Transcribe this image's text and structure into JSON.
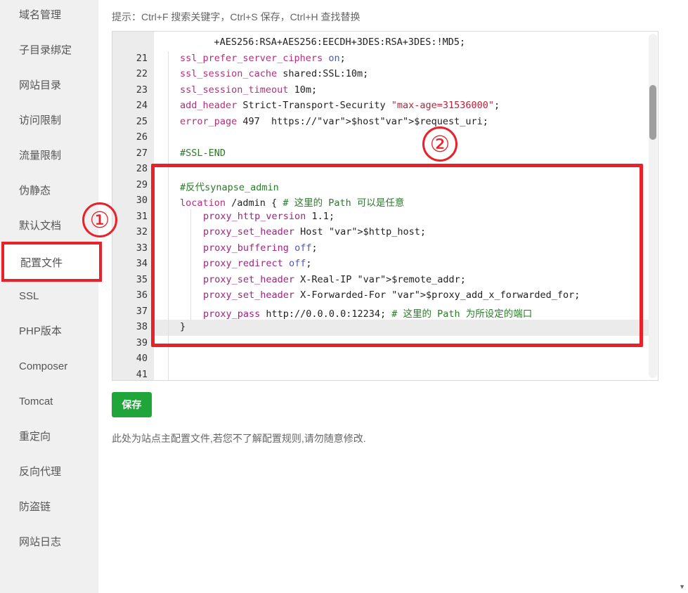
{
  "sidebar": {
    "items": [
      {
        "label": "域名管理"
      },
      {
        "label": "子目录绑定"
      },
      {
        "label": "网站目录"
      },
      {
        "label": "访问限制"
      },
      {
        "label": "流量限制"
      },
      {
        "label": "伪静态"
      },
      {
        "label": "默认文档"
      },
      {
        "label": "配置文件",
        "active": true
      },
      {
        "label": "SSL"
      },
      {
        "label": "PHP版本"
      },
      {
        "label": "Composer"
      },
      {
        "label": "Tomcat"
      },
      {
        "label": "重定向"
      },
      {
        "label": "反向代理"
      },
      {
        "label": "防盗链"
      },
      {
        "label": "网站日志"
      }
    ]
  },
  "hint": "提示：Ctrl+F 搜索关键字，Ctrl+S 保存，Ctrl+H 查找替换",
  "editor": {
    "lines": [
      {
        "n": "",
        "text": "    +AES256:RSA+AES256:EECDH+3DES:RSA+3DES:!MD5;"
      },
      {
        "n": "21",
        "text": "ssl_prefer_server_ciphers on;"
      },
      {
        "n": "22",
        "text": "ssl_session_cache shared:SSL:10m;"
      },
      {
        "n": "23",
        "text": "ssl_session_timeout 10m;"
      },
      {
        "n": "24",
        "text": "add_header Strict-Transport-Security \"max-age=31536000\";"
      },
      {
        "n": "25",
        "text": "error_page 497  https://$host$request_uri;"
      },
      {
        "n": "26",
        "text": ""
      },
      {
        "n": "27",
        "text": "#SSL-END"
      },
      {
        "n": "28",
        "text": ""
      },
      {
        "n": "29",
        "text": "#反代synapse_admin"
      },
      {
        "n": "30",
        "text": "location /admin { # 这里的 Path 可以是任意"
      },
      {
        "n": "31",
        "text": "proxy_http_version 1.1;"
      },
      {
        "n": "32",
        "text": "proxy_set_header Host $http_host;"
      },
      {
        "n": "33",
        "text": "proxy_buffering off;"
      },
      {
        "n": "34",
        "text": "proxy_redirect off;"
      },
      {
        "n": "35",
        "text": "proxy_set_header X-Real-IP $remote_addr;"
      },
      {
        "n": "36",
        "text": "proxy_set_header X-Forwarded-For $proxy_add_x_forwarded_for;"
      },
      {
        "n": "37",
        "text": "proxy_pass http://0.0.0.0:12234; # 这里的 Path 为所设定的端口"
      },
      {
        "n": "38",
        "text": "}"
      },
      {
        "n": "39",
        "text": ""
      },
      {
        "n": "40",
        "text": ""
      },
      {
        "n": "41",
        "text": ""
      }
    ]
  },
  "save_label": "保存",
  "note": "此处为站点主配置文件,若您不了解配置规则,请勿随意修改.",
  "annotations": {
    "marker_1": "①",
    "marker_2": "②"
  },
  "colors": {
    "accent_red": "#e8212b",
    "save_green": "#20a53a"
  }
}
